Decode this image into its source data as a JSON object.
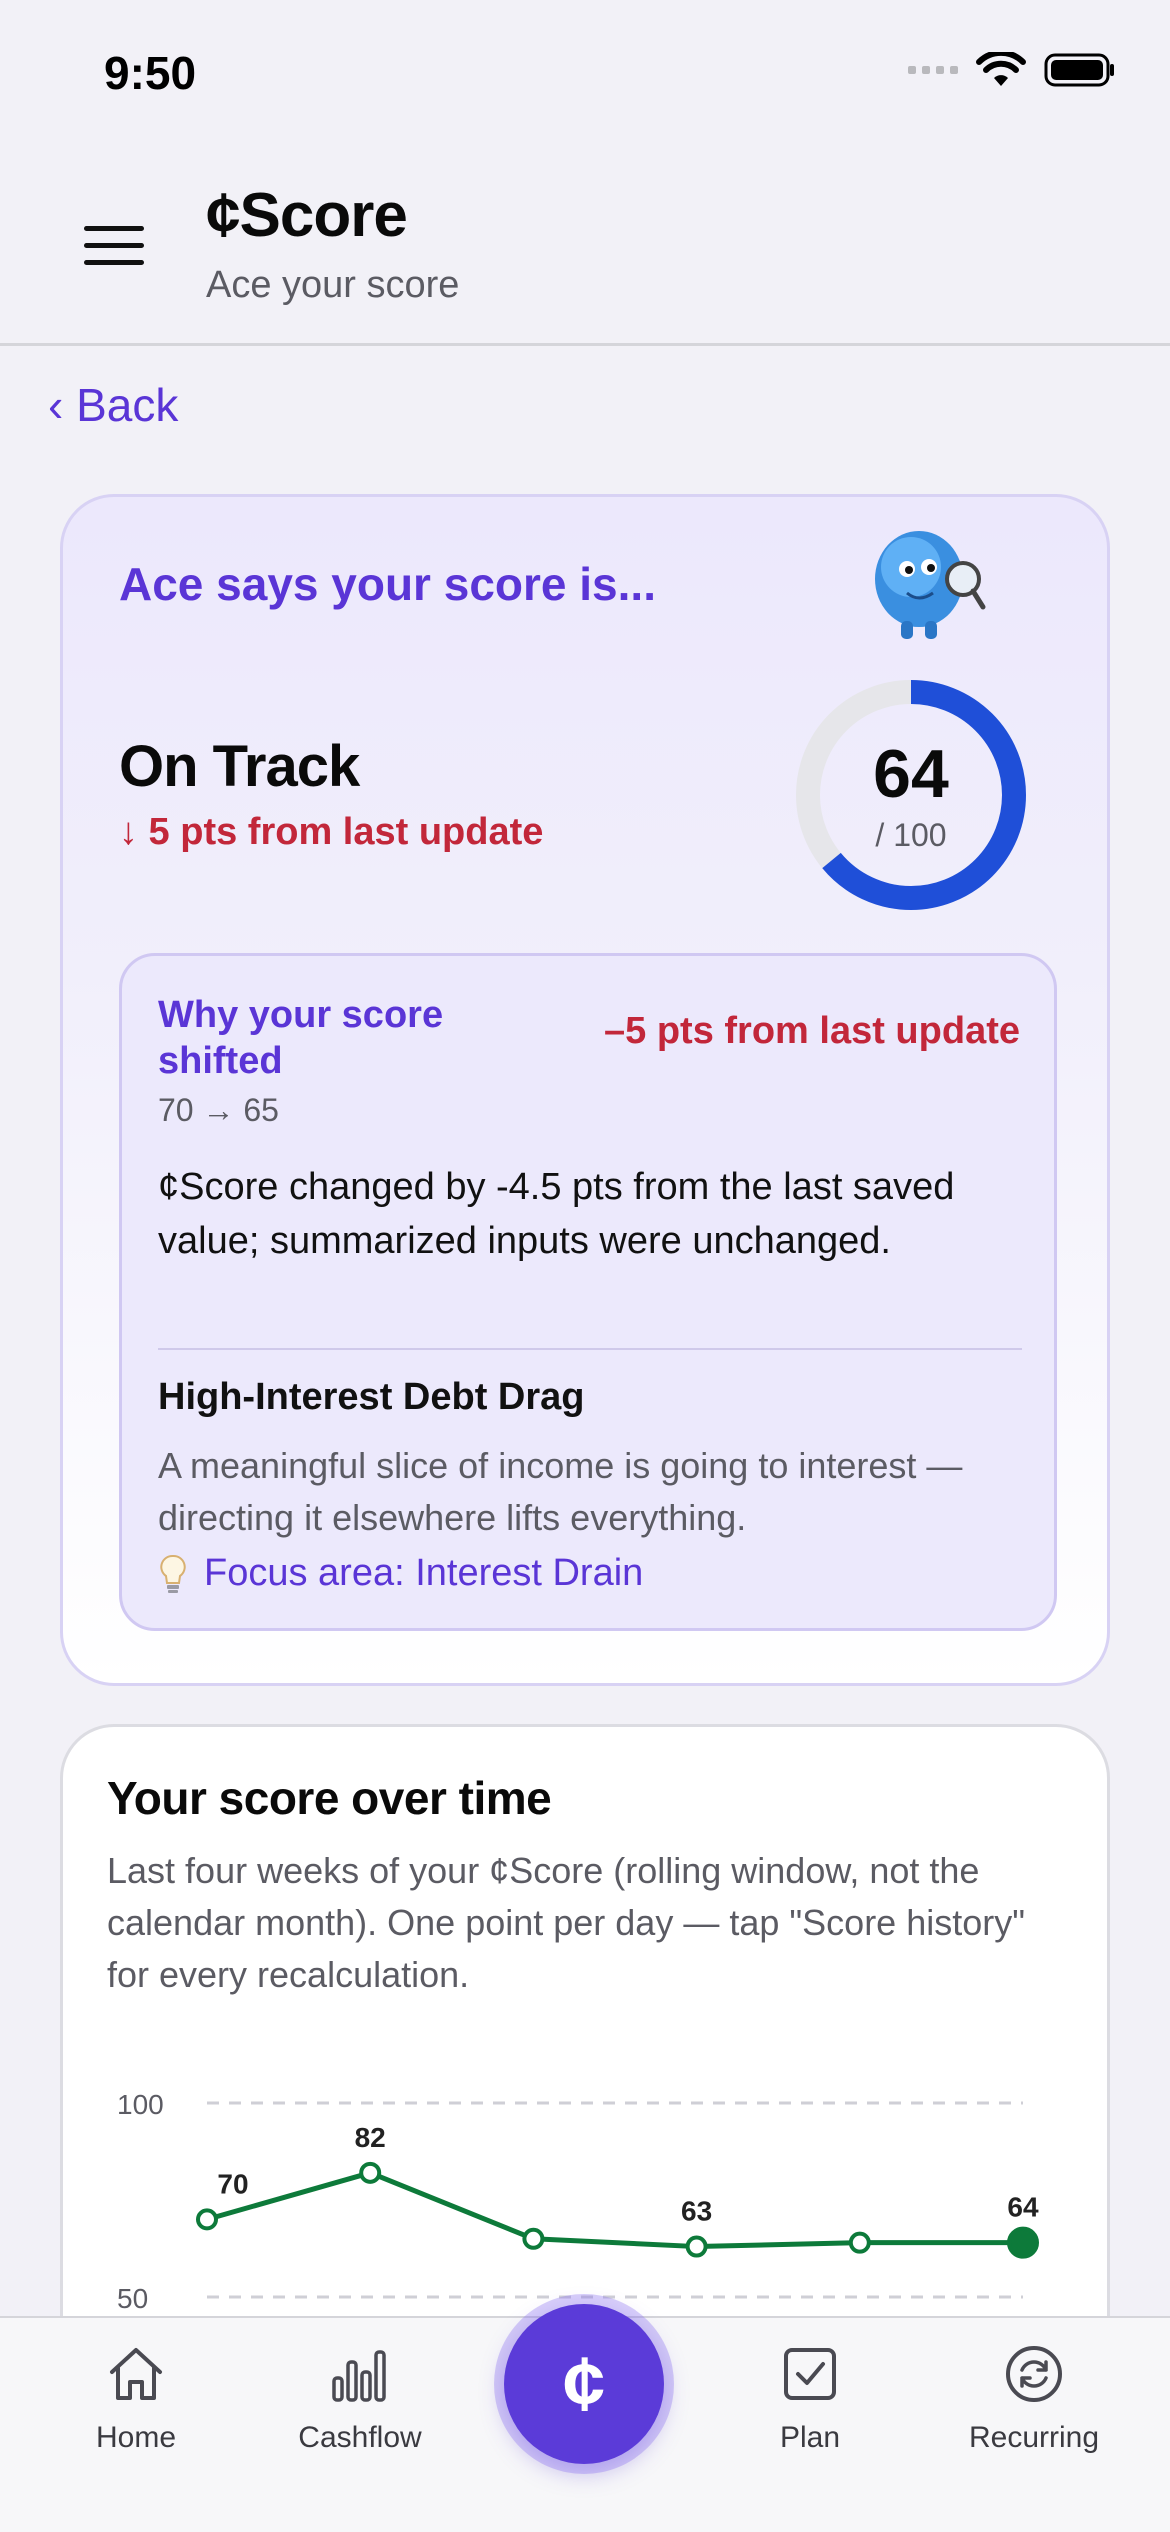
{
  "status_bar": {
    "time": "9:50"
  },
  "header": {
    "title": "¢Score",
    "subtitle": "Ace your score"
  },
  "nav": {
    "back_label": "‹ Back"
  },
  "score_card": {
    "headline": "Ace says your score is...",
    "status": "On Track",
    "change": "↓ 5 pts from last update",
    "score": "64",
    "score_max": "/ 100",
    "score_fraction": 0.64,
    "colors": {
      "accent": "#5a35d6",
      "gauge": "#1f4fd8",
      "negative": "#c2273a"
    }
  },
  "why_box": {
    "title": "Why your score shifted",
    "change": "–5 pts from last update",
    "range": "70 → 65",
    "description": "¢Score changed by -4.5 pts from the last saved value; summarized inputs were unchanged.",
    "driver_title": "High-Interest Debt Drag",
    "driver_description": "A meaningful slice of income is going to interest — directing it elsewhere lifts everything.",
    "focus_icon": "lightbulb-icon",
    "focus_label": "Focus area: Interest Drain"
  },
  "history_card": {
    "title": "Your score over time",
    "description": "Last four weeks of your ¢Score (rolling window, not the calendar month). One point per day — tap \"Score history\" for every recalculation."
  },
  "chart_data": {
    "type": "line",
    "y_ticks": [
      "100",
      "50"
    ],
    "ylim": [
      50,
      100
    ],
    "grid": true,
    "points": [
      {
        "label": "70",
        "value": 70,
        "shown": true
      },
      {
        "label": "82",
        "value": 82,
        "shown": true
      },
      {
        "label": "",
        "value": 65,
        "shown": false
      },
      {
        "label": "63",
        "value": 63,
        "shown": true
      },
      {
        "label": "",
        "value": 64,
        "shown": false
      },
      {
        "label": "64",
        "value": 64,
        "shown": true
      }
    ],
    "line_color": "#0d7a3a"
  },
  "tab_bar": {
    "home": "Home",
    "cashflow": "Cashflow",
    "center": "¢",
    "plan": "Plan",
    "recurring": "Recurring"
  }
}
